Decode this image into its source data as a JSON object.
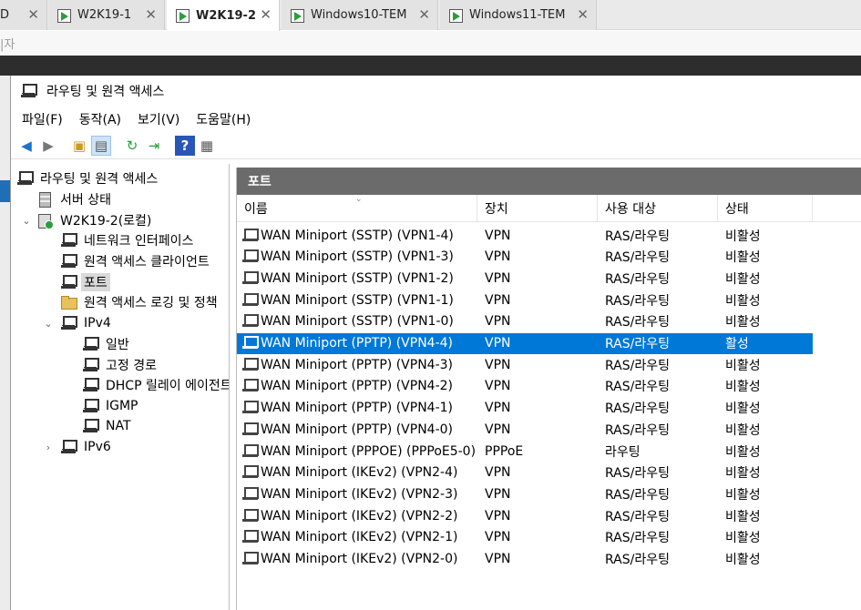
{
  "browser": {
    "tabs": [
      {
        "label": "D",
        "active": false
      },
      {
        "label": "W2K19-1",
        "active": false
      },
      {
        "label": "W2K19-2",
        "active": true
      },
      {
        "label": "Windows10-TEM",
        "active": false
      },
      {
        "label": "Windows11-TEM",
        "active": false
      }
    ],
    "close_glyph": "✕",
    "sub_text": "|자"
  },
  "window": {
    "title": "라우팅 및 원격 액세스"
  },
  "menu": [
    "파일(F)",
    "동작(A)",
    "보기(V)",
    "도움말(H)"
  ],
  "tree": {
    "items": [
      {
        "label": "라우팅 및 원격 액세스",
        "icon": "network-icon"
      },
      {
        "label": "서버 상태",
        "icon": "server-icon"
      },
      {
        "label": "W2K19-2(로컬)",
        "icon": "computer-icon",
        "expander": "⌄"
      },
      {
        "label": "네트워크 인터페이스",
        "icon": "network-icon"
      },
      {
        "label": "원격 액세스 클라이언트",
        "icon": "network-icon"
      },
      {
        "label": "포트",
        "icon": "network-icon",
        "selected": true
      },
      {
        "label": "원격 액세스 로깅 및 정책",
        "icon": "folder-icon"
      },
      {
        "label": "IPv4",
        "icon": "network-icon",
        "expander": "⌄"
      },
      {
        "label": "일반",
        "icon": "network-icon"
      },
      {
        "label": "고정 경로",
        "icon": "network-icon"
      },
      {
        "label": "DHCP 릴레이 에이전트",
        "icon": "network-icon"
      },
      {
        "label": "IGMP",
        "icon": "network-icon"
      },
      {
        "label": "NAT",
        "icon": "network-icon"
      },
      {
        "label": "IPv6",
        "icon": "network-icon",
        "expander": "›"
      }
    ]
  },
  "ports": {
    "title": "포트",
    "columns": [
      "이름",
      "장치",
      "사용 대상",
      "상태"
    ],
    "sort_indicator": "⌄",
    "rows": [
      {
        "name": "WAN Miniport (SSTP) (VPN1-4)",
        "device": "VPN",
        "usage": "RAS/라우팅",
        "status": "비활성"
      },
      {
        "name": "WAN Miniport (SSTP) (VPN1-3)",
        "device": "VPN",
        "usage": "RAS/라우팅",
        "status": "비활성"
      },
      {
        "name": "WAN Miniport (SSTP) (VPN1-2)",
        "device": "VPN",
        "usage": "RAS/라우팅",
        "status": "비활성"
      },
      {
        "name": "WAN Miniport (SSTP) (VPN1-1)",
        "device": "VPN",
        "usage": "RAS/라우팅",
        "status": "비활성"
      },
      {
        "name": "WAN Miniport (SSTP) (VPN1-0)",
        "device": "VPN",
        "usage": "RAS/라우팅",
        "status": "비활성"
      },
      {
        "name": "WAN Miniport (PPTP) (VPN4-4)",
        "device": "VPN",
        "usage": "RAS/라우팅",
        "status": "활성",
        "selected": true
      },
      {
        "name": "WAN Miniport (PPTP) (VPN4-3)",
        "device": "VPN",
        "usage": "RAS/라우팅",
        "status": "비활성"
      },
      {
        "name": "WAN Miniport (PPTP) (VPN4-2)",
        "device": "VPN",
        "usage": "RAS/라우팅",
        "status": "비활성"
      },
      {
        "name": "WAN Miniport (PPTP) (VPN4-1)",
        "device": "VPN",
        "usage": "RAS/라우팅",
        "status": "비활성"
      },
      {
        "name": "WAN Miniport (PPTP) (VPN4-0)",
        "device": "VPN",
        "usage": "RAS/라우팅",
        "status": "비활성"
      },
      {
        "name": "WAN Miniport (PPPOE) (PPPoE5-0)",
        "device": "PPPoE",
        "usage": "라우팅",
        "status": "비활성"
      },
      {
        "name": "WAN Miniport (IKEv2) (VPN2-4)",
        "device": "VPN",
        "usage": "RAS/라우팅",
        "status": "비활성"
      },
      {
        "name": "WAN Miniport (IKEv2) (VPN2-3)",
        "device": "VPN",
        "usage": "RAS/라우팅",
        "status": "비활성"
      },
      {
        "name": "WAN Miniport (IKEv2) (VPN2-2)",
        "device": "VPN",
        "usage": "RAS/라우팅",
        "status": "비활성"
      },
      {
        "name": "WAN Miniport (IKEv2) (VPN2-1)",
        "device": "VPN",
        "usage": "RAS/라우팅",
        "status": "비활성"
      },
      {
        "name": "WAN Miniport (IKEv2) (VPN2-0)",
        "device": "VPN",
        "usage": "RAS/라우팅",
        "status": "비활성"
      }
    ]
  },
  "colors": {
    "selection": "#0078d7",
    "pane_title_bg": "#6b6b6b"
  }
}
